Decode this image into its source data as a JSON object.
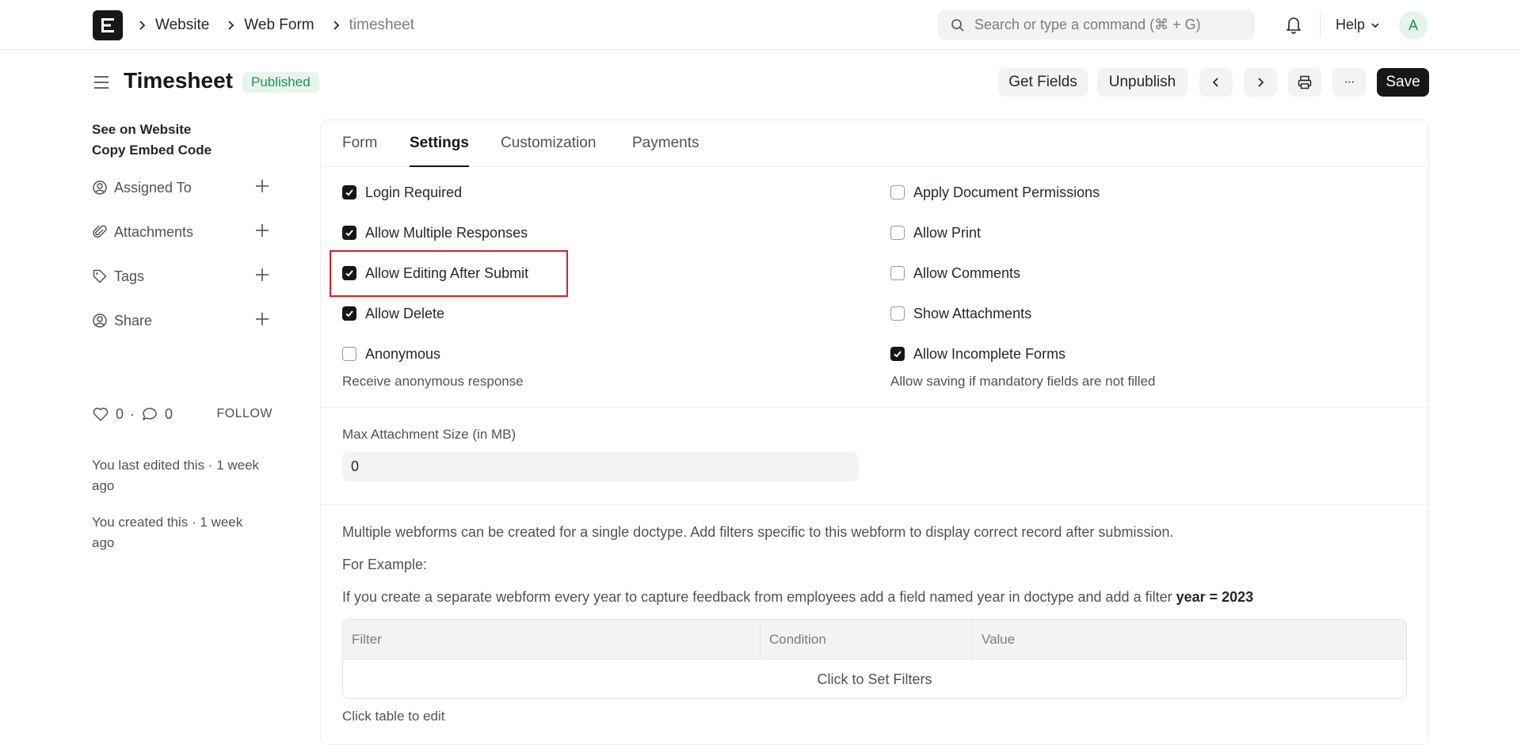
{
  "nav": {
    "breadcrumbs": [
      "Website",
      "Web Form",
      "timesheet"
    ],
    "search_placeholder": "Search or type a command (⌘ + G)",
    "help_label": "Help",
    "avatar_initial": "A"
  },
  "header": {
    "title": "Timesheet",
    "status": "Published",
    "get_fields": "Get Fields",
    "unpublish": "Unpublish",
    "more": "···",
    "save": "Save"
  },
  "sidebar": {
    "links": [
      "See on Website",
      "Copy Embed Code"
    ],
    "items": [
      {
        "label": "Assigned To",
        "icon": "assigned-icon"
      },
      {
        "label": "Attachments",
        "icon": "paperclip-icon"
      },
      {
        "label": "Tags",
        "icon": "tag-icon"
      },
      {
        "label": "Share",
        "icon": "share-icon"
      }
    ],
    "likes": "0",
    "comments": "0",
    "dot": "·",
    "follow": "FOLLOW",
    "activity": [
      "You last edited this · 1 week ago",
      "You created this · 1 week ago"
    ]
  },
  "tabs": [
    "Form",
    "Settings",
    "Customization",
    "Payments"
  ],
  "settings": {
    "left": [
      {
        "label": "Login Required",
        "checked": true
      },
      {
        "label": "Allow Multiple Responses",
        "checked": true
      },
      {
        "label": "Allow Editing After Submit",
        "checked": true
      },
      {
        "label": "Allow Delete",
        "checked": true
      },
      {
        "label": "Anonymous",
        "checked": false
      }
    ],
    "right": [
      {
        "label": "Apply Document Permissions",
        "checked": false
      },
      {
        "label": "Allow Print",
        "checked": false
      },
      {
        "label": "Allow Comments",
        "checked": false
      },
      {
        "label": "Show Attachments",
        "checked": false
      },
      {
        "label": "Allow Incomplete Forms",
        "checked": true
      }
    ],
    "anonymous_desc": "Receive anonymous response",
    "incomplete_desc": "Allow saving if mandatory fields are not filled",
    "max_attachment_label": "Max Attachment Size (in MB)",
    "max_attachment_value": "0"
  },
  "filters": {
    "para1": "Multiple webforms can be created for a single doctype. Add filters specific to this webform to display correct record after submission.",
    "para2": "For Example:",
    "para3_prefix": "If you create a separate webform every year to capture feedback from employees add a field named year in doctype and add a filter ",
    "para3_bold": "year = 2023",
    "columns": [
      "Filter",
      "Condition",
      "Value"
    ],
    "empty_text": "Click to Set Filters",
    "help_text": "Click table to edit"
  },
  "colors": {
    "accent": "#171717",
    "success": "#278f5e",
    "highlight": "#d4202c"
  }
}
